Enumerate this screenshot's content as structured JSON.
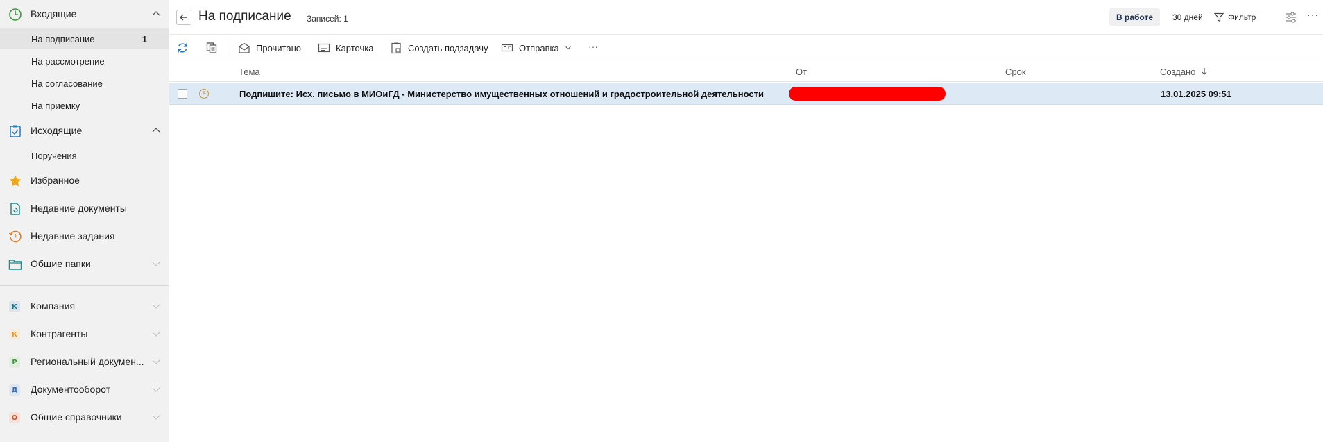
{
  "sidebar": {
    "inbox": {
      "label": "Входящие",
      "icon": "clock-icon"
    },
    "inbox_items": [
      {
        "label": "На подписание",
        "count": "1"
      },
      {
        "label": "На рассмотрение"
      },
      {
        "label": "На согласование"
      },
      {
        "label": "На приемку"
      }
    ],
    "outbox": {
      "label": "Исходящие",
      "icon": "clipboard-check-icon"
    },
    "outbox_items": [
      {
        "label": "Поручения"
      }
    ],
    "favorites": {
      "label": "Избранное",
      "icon": "star-icon"
    },
    "recent_docs": {
      "label": "Недавние документы",
      "icon": "document-icon"
    },
    "recent_tasks": {
      "label": "Недавние задания",
      "icon": "history-icon"
    },
    "shared_folders": {
      "label": "Общие папки",
      "icon": "folder-icon"
    },
    "modules": [
      {
        "letter": "К",
        "label": "Компания",
        "color": "#1d7a8c"
      },
      {
        "letter": "К",
        "label": "Контрагенты",
        "color": "#e8952a"
      },
      {
        "letter": "Р",
        "label": "Региональный докумен...",
        "color": "#3a9a3a"
      },
      {
        "letter": "Д",
        "label": "Документооборот",
        "color": "#3a6fb5"
      },
      {
        "letter": "О",
        "label": "Общие справочники",
        "color": "#d8502a"
      }
    ]
  },
  "header": {
    "title": "На подписание",
    "records": "Записей: 1",
    "in_work": "В работе",
    "days": "30 дней",
    "filter": "Фильтр"
  },
  "toolbar": {
    "read": "Прочитано",
    "card": "Карточка",
    "create_subtask": "Создать подзадачу",
    "send": "Отправка"
  },
  "table": {
    "columns": {
      "subject": "Тема",
      "from": "От",
      "deadline": "Срок",
      "created": "Создано"
    },
    "rows": [
      {
        "subject": "Подпишите: Исх. письмо в МИОиГД - Министерство имущественных отношений и градостроительной деятельности",
        "from": "",
        "deadline": "",
        "created": "13.01.2025 09:51"
      }
    ]
  },
  "colors": {
    "accent_green": "#3a9a3a",
    "accent_blue": "#2a7ac0",
    "row_selected": "#dde9f5",
    "redaction": "#ff0000"
  }
}
